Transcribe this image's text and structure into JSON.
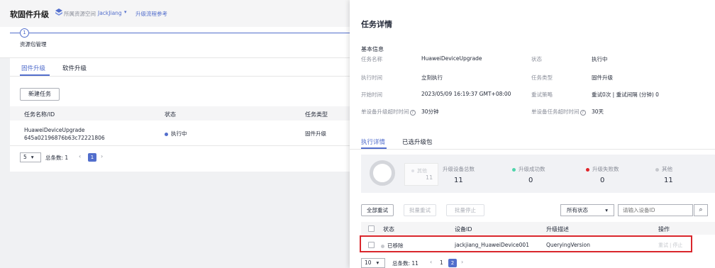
{
  "header": {
    "title": "软固件升级",
    "workspace": "所属资源空间",
    "workspace_value": "JackJiang",
    "guide_link": "升级流程参考"
  },
  "steps": {
    "current": "1",
    "label": "资源包管理"
  },
  "tabs": [
    "固件升级",
    "软件升级"
  ],
  "toolbar": {
    "new_task": "新建任务"
  },
  "task_table": {
    "columns": [
      "任务名称/ID",
      "状态",
      "任务类型"
    ],
    "row": {
      "name": "HuaweiDeviceUpgrade",
      "id": "645a02196876b63c72221806",
      "status": "执行中",
      "type": "固件升级"
    }
  },
  "left_pagination": {
    "page_size": "5",
    "total": "总条数: 1",
    "page": "1"
  },
  "panel": {
    "title": "任务详情",
    "section": "基本信息",
    "fields": {
      "name_label": "任务名称",
      "name_value": "HuaweiDeviceUpgrade",
      "status_label": "状态",
      "status_value": "执行中",
      "exec_label": "执行时间",
      "exec_value": "立刻执行",
      "type_label": "任务类型",
      "type_value": "固件升级",
      "start_label": "开始时间",
      "start_value": "2023/05/09 16:19:37 GMT+08:00",
      "retry_label": "重试策略",
      "retry_value": "重试0次 | 重试间隔 (分钟) 0",
      "timeout_label": "单设备升级超时时间",
      "timeout_value": "30分钟",
      "task_timeout_label": "单设备任务超时时间",
      "task_timeout_value": "30天",
      "help": "?"
    },
    "detail_tabs": [
      "执行详情",
      "已选升级包"
    ],
    "summary": {
      "tooltip_label": "其他",
      "tooltip_value": "11",
      "total_label": "升级设备总数",
      "total_value": "11",
      "success_label": "升级成功数",
      "success_value": "0",
      "fail_label": "升级失败数",
      "fail_value": "0",
      "other_label": "其他",
      "other_value": "11"
    },
    "actions": {
      "retry_all": "全部重试",
      "batch_retry": "批量重试",
      "batch_stop": "批量停止"
    },
    "status_filter": "所有状态",
    "search_placeholder": "请输入设备ID",
    "device_table": {
      "columns": [
        "状态",
        "设备ID",
        "升级描述",
        "操作"
      ],
      "row": {
        "status": "已移除",
        "device_id": "jackjiang_HuaweiDevice001",
        "desc": "QueryingVersion",
        "retry": "重试",
        "sep": "|",
        "stop": "停止"
      }
    },
    "pagination": {
      "page_size": "10",
      "total": "总条数: 11",
      "page1": "1",
      "page2": "2"
    }
  },
  "colors": {
    "accent": "#526ecc",
    "success": "#50d4ab",
    "fail": "#e0252a",
    "other": "#c6c8cd",
    "highlight": "#d9262c"
  }
}
